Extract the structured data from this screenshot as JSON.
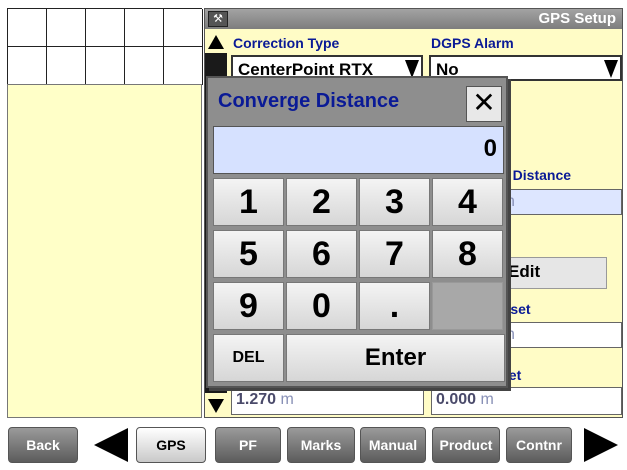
{
  "panel": {
    "title": "GPS Setup",
    "correction_type_label": "Correction Type",
    "correction_type_value": "CenterPoint RTX",
    "dgps_alarm_label": "DGPS Alarm",
    "dgps_alarm_value": "No",
    "partial_labels": {
      "distance": "e Distance",
      "setup": "p",
      "offset1": "ffset",
      "offset2": "set"
    },
    "fields": {
      "distance_unit": "n",
      "edit_label": "Edit",
      "offset1_unit": "n",
      "offset2_unit": "m",
      "left_value": "1.270",
      "left_unit": " m",
      "right_value": "0.000",
      "right_unit": " m"
    }
  },
  "dialog": {
    "title": "Converge Distance",
    "close_symbol": "✕",
    "display_value": "0",
    "keys": [
      "1",
      "2",
      "3",
      "4",
      "5",
      "6",
      "7",
      "8",
      "9",
      "0",
      "."
    ],
    "del_label": "DEL",
    "enter_label": "Enter"
  },
  "bottom_nav": {
    "back_label": "Back",
    "gps_label": "GPS",
    "pf_label": "PF",
    "marks_label": "Marks",
    "manual_label": "Manual",
    "product_label": "Product",
    "contnr_label": "Contnr"
  },
  "colors": {
    "label_blue": "#0a1a96",
    "panel_yellow": "#fffcc6",
    "field_blue": "#dde6ff"
  }
}
